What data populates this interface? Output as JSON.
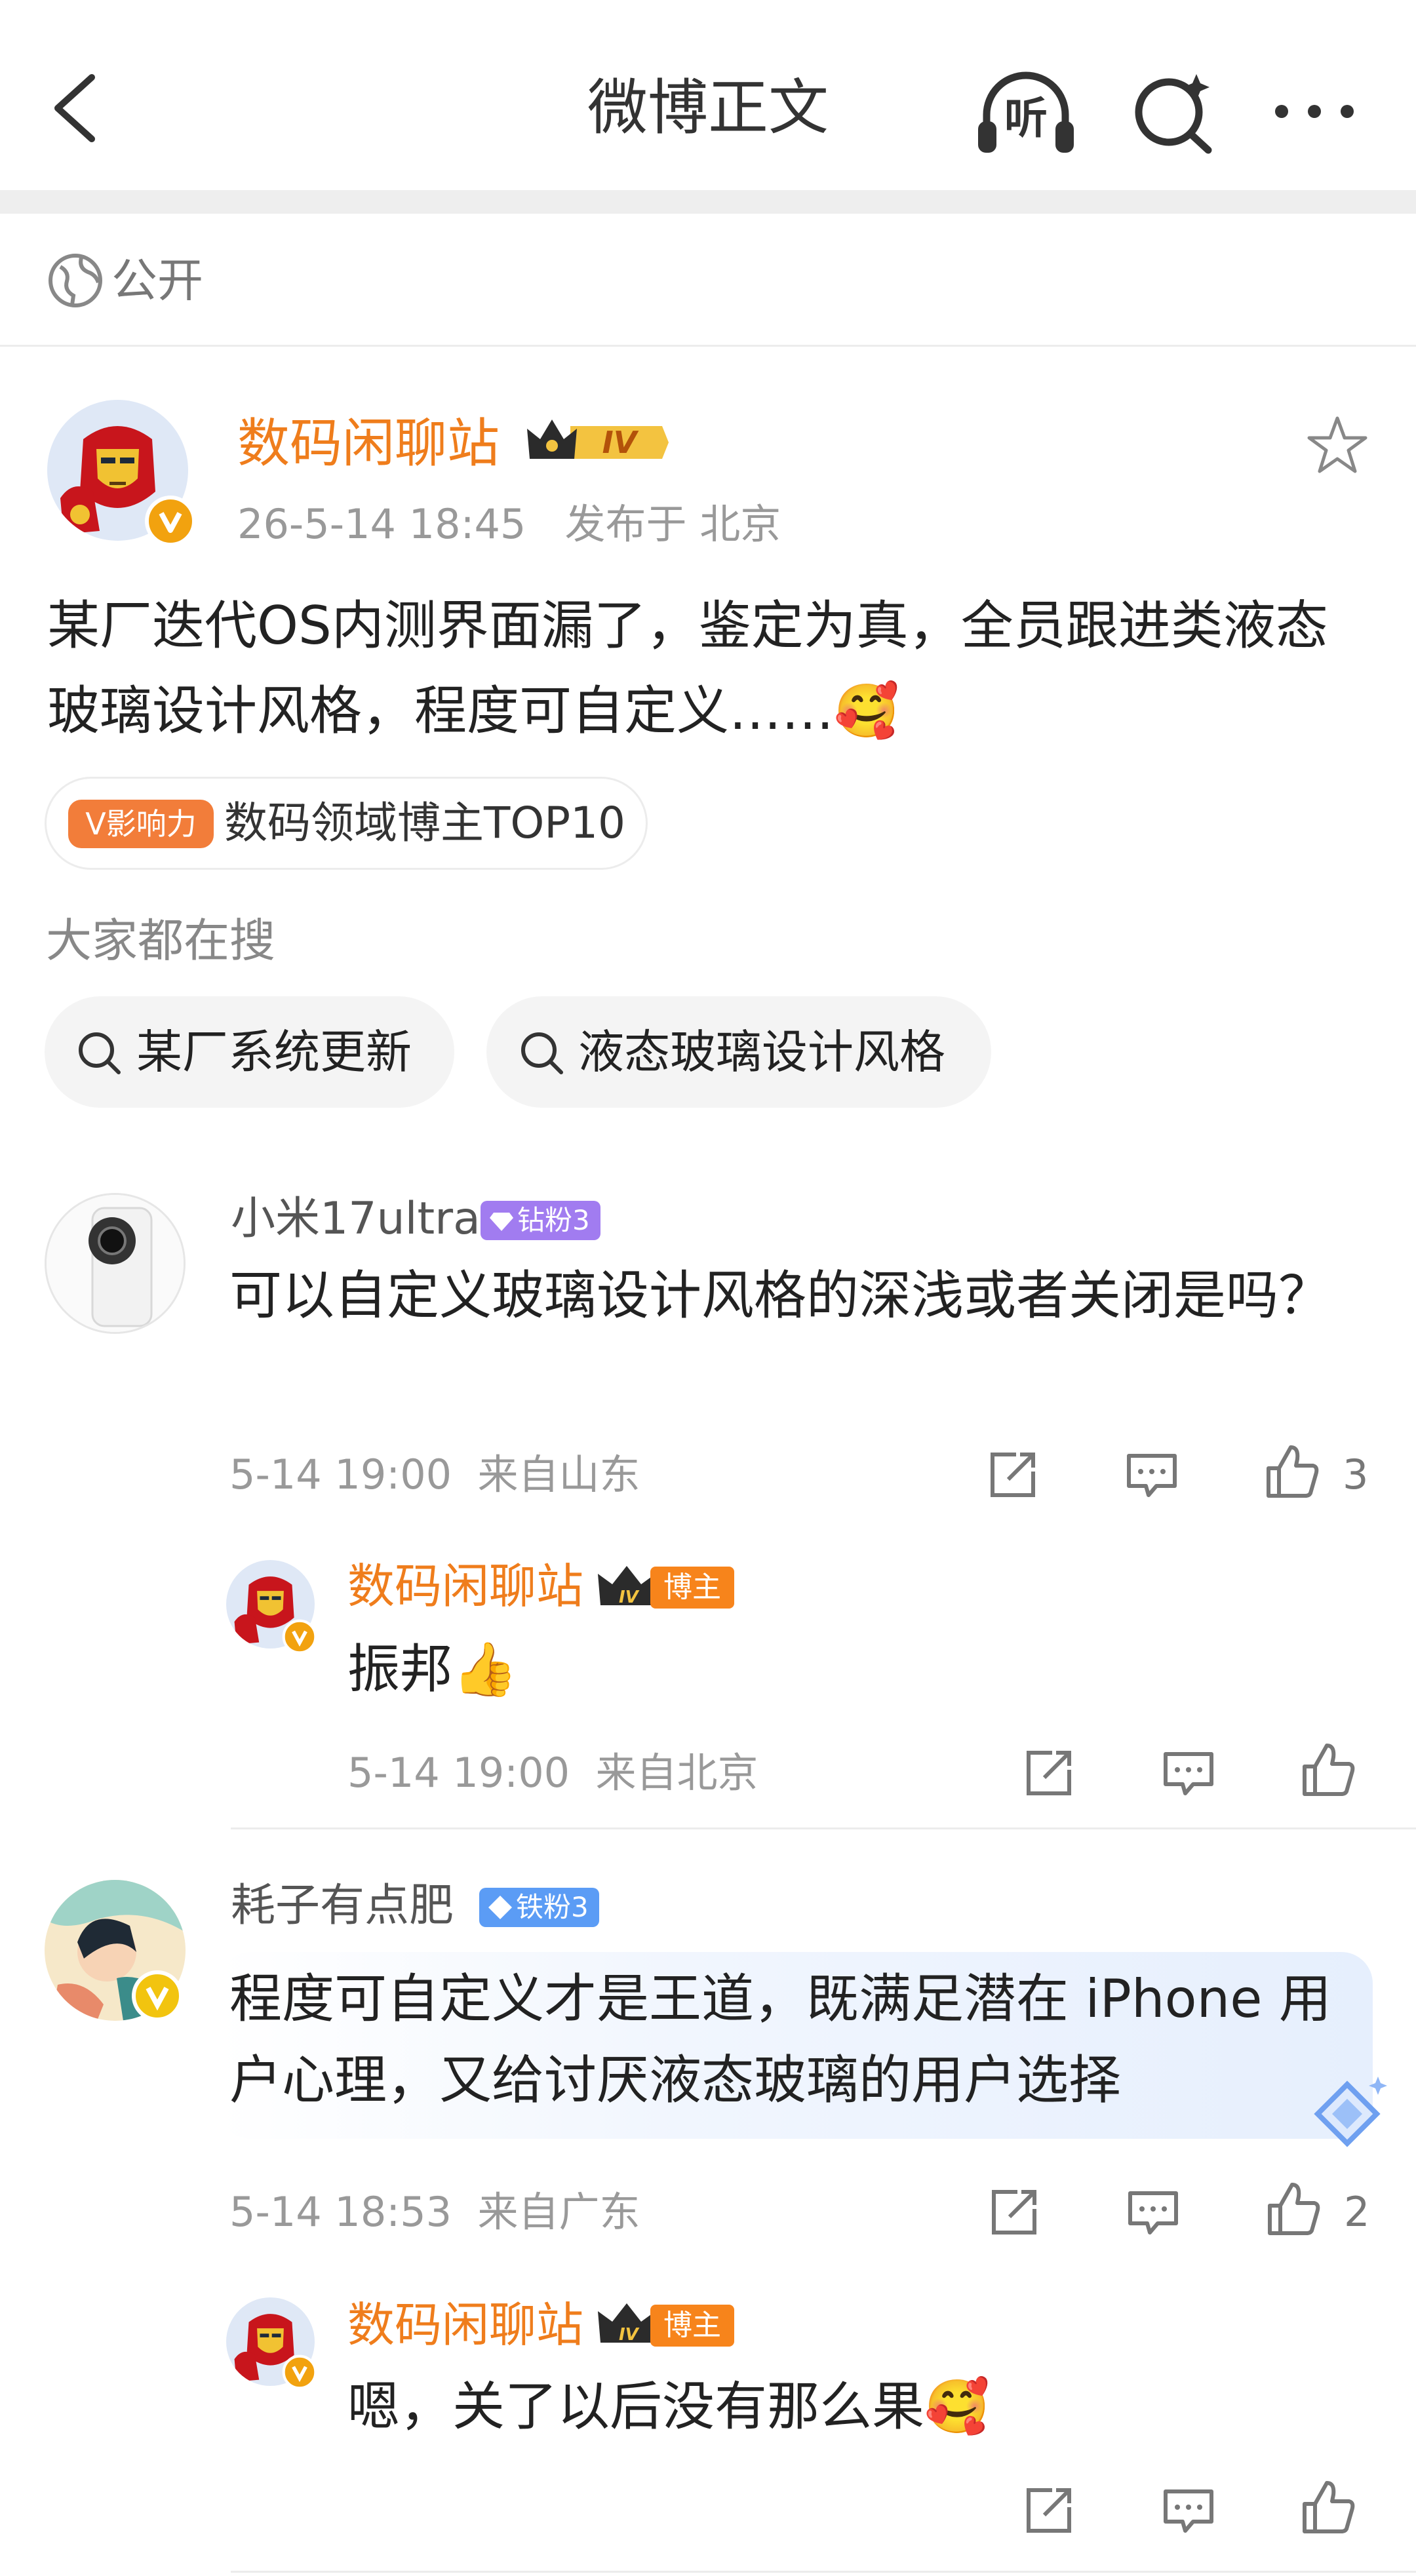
{
  "header": {
    "title": "微博正文",
    "listen_label": "听",
    "icons": [
      "back-arrow-icon",
      "listen-headphones-icon",
      "ai-search-icon",
      "more-icon"
    ]
  },
  "visibility": {
    "label": "公开",
    "icon": "globe-icon"
  },
  "post": {
    "author": "数码闲聊站",
    "level_badge": "IV",
    "timestamp": "26-5-14 18:45",
    "location": "发布于 北京",
    "text": "某厂迭代OS内测界面漏了，鉴定为真，全员跟进类液态玻璃设计风格，程度可自定义……🥰",
    "influence_tag": "V影响力",
    "influence_text": "数码领域博主TOP10",
    "search_heading": "大家都在搜",
    "search_chips": [
      "某厂系统更新",
      "液态玻璃设计风格"
    ]
  },
  "comments": [
    {
      "user": "小米17ultra",
      "fan_badge": "钻粉3",
      "fan_color": "#a17cf0",
      "text": "可以自定义玻璃设计风格的深浅或者关闭是吗？",
      "time": "5-14 19:00",
      "source": "来自山东",
      "likes": "3",
      "reply": {
        "user": "数码闲聊站",
        "author_badge": "博主",
        "text": "振邦👍",
        "time": "5-14 19:00",
        "source": "来自北京"
      }
    },
    {
      "user": "耗子有点肥",
      "fan_badge": "铁粉3",
      "fan_color": "#5b9cf5",
      "text": "程度可自定义才是王道，既满足潜在 iPhone 用户心理，又给讨厌液态玻璃的用户选择",
      "time": "5-14 18:53",
      "source": "来自广东",
      "likes": "2",
      "reply": {
        "user": "数码闲聊站",
        "author_badge": "博主",
        "text": "嗯，关了以后没有那么果🥰"
      }
    }
  ],
  "colors": {
    "brand_orange": "#ef7d1c",
    "verified": "#f2a20f",
    "text": "#222222",
    "meta": "#999999"
  }
}
